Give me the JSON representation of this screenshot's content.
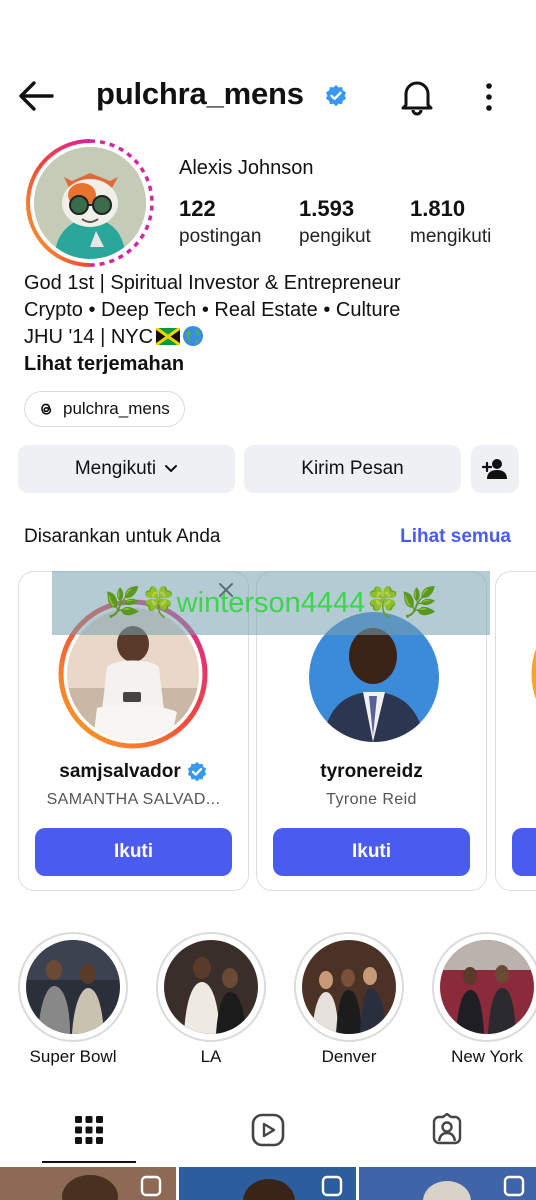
{
  "header": {
    "username": "pulchra_mens",
    "icons": {
      "back": "arrow-left-icon",
      "verified": "verified-badge-icon",
      "bell": "bell-icon",
      "menu": "more-vertical-icon"
    }
  },
  "profile": {
    "display_name": "Alexis Johnson",
    "stats": [
      {
        "value": "122",
        "label": "postingan"
      },
      {
        "value": "1.593",
        "label": "pengikut"
      },
      {
        "value": "1.810",
        "label": "mengikuti"
      }
    ],
    "bio_lines": [
      "God 1st | Spiritual Investor & Entrepreneur",
      "Crypto • Deep Tech • Real Estate • Culture",
      "JHU '14 | NYC"
    ],
    "see_translation": "Lihat terjemahan",
    "threads_handle": "pulchra_mens"
  },
  "actions": {
    "following_label": "Mengikuti",
    "message_label": "Kirim Pesan",
    "add_user_icon": "add-user-icon"
  },
  "suggestions": {
    "title": "Disarankan untuk Anda",
    "see_all": "Lihat semua",
    "cards": [
      {
        "username": "samjsalvador",
        "full_name": "SAMANTHA SALVAD...",
        "verified": true,
        "button": "Ikuti"
      },
      {
        "username": "tyronereidz",
        "full_name": "Tyrone Reid",
        "verified": false,
        "button": "Ikuti"
      }
    ]
  },
  "watermark": {
    "text": "🌿🍀winterson4444🍀🌿"
  },
  "highlights": [
    {
      "label": "Super Bowl"
    },
    {
      "label": "LA"
    },
    {
      "label": "Denver"
    },
    {
      "label": "New York"
    }
  ],
  "tabs": [
    {
      "icon": "grid-icon",
      "active": true
    },
    {
      "icon": "reels-icon",
      "active": false
    },
    {
      "icon": "tagged-icon",
      "active": false
    }
  ],
  "colors": {
    "accent": "#4a5bf0",
    "verified": "#3897f0",
    "button_grey": "#eef0f3",
    "watermark_text": "#3bd64a"
  }
}
